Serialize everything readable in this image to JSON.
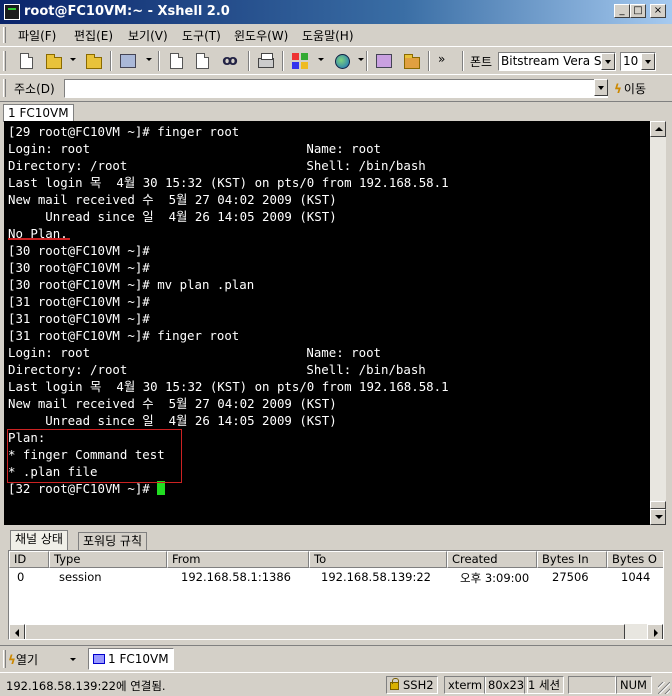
{
  "window": {
    "title": "root@FC10VM:~ - Xshell 2.0"
  },
  "menu": [
    "파일(F)",
    "편집(E)",
    "보기(V)",
    "도구(T)",
    "윈도우(W)",
    "도움말(H)"
  ],
  "toolbar": {
    "more": "»",
    "font_label": "폰트",
    "font_value": "Bitstream Vera S",
    "size_value": "10"
  },
  "address": {
    "label": "주소(D)",
    "value": "",
    "go_label": "이동"
  },
  "tabs": [
    "1 FC10VM"
  ],
  "terminal": {
    "lines": [
      "[29 root@FC10VM ~]# finger root",
      "Login: root                             Name: root",
      "Directory: /root                        Shell: /bin/bash",
      "Last login 목  4월 30 15:32 (KST) on pts/0 from 192.168.58.1",
      "New mail received 수  5월 27 04:02 2009 (KST)",
      "     Unread since 일  4월 26 14:05 2009 (KST)",
      "No Plan.",
      "[30 root@FC10VM ~]#",
      "[30 root@FC10VM ~]#",
      "[30 root@FC10VM ~]# mv plan .plan",
      "[31 root@FC10VM ~]#",
      "[31 root@FC10VM ~]#",
      "[31 root@FC10VM ~]# finger root",
      "Login: root                             Name: root",
      "Directory: /root                        Shell: /bin/bash",
      "Last login 목  4월 30 15:32 (KST) on pts/0 from 192.168.58.1",
      "New mail received 수  5월 27 04:02 2009 (KST)",
      "     Unread since 일  4월 26 14:05 2009 (KST)",
      "Plan:",
      "* finger Command test",
      "* .plan file"
    ],
    "prompt": "[32 root@FC10VM ~]# "
  },
  "panel": {
    "tabs": [
      "채널 상태",
      "포워딩 규칙"
    ],
    "columns": [
      "ID",
      "Type",
      "From",
      "To",
      "Created",
      "Bytes In",
      "Bytes O"
    ],
    "rows": [
      [
        "0",
        "session",
        "192.168.58.1:1386",
        "192.168.58.139:22",
        "오후 3:09:00",
        "27506",
        "1044"
      ]
    ]
  },
  "taskbar": {
    "open_label": "열기",
    "session_label": "1 FC10VM"
  },
  "status": {
    "text": "192.168.58.139:22에 연결됨.",
    "protocol": "SSH2",
    "term": "xterm",
    "size": "80x23",
    "sessions": "1 세션",
    "num": "NUM"
  },
  "colors": {
    "terminal_bg": "#000000",
    "terminal_fg": "#ffffff",
    "cursor": "#22dd22",
    "highlight": "#cc2222",
    "chrome": "#d4d0c8"
  }
}
